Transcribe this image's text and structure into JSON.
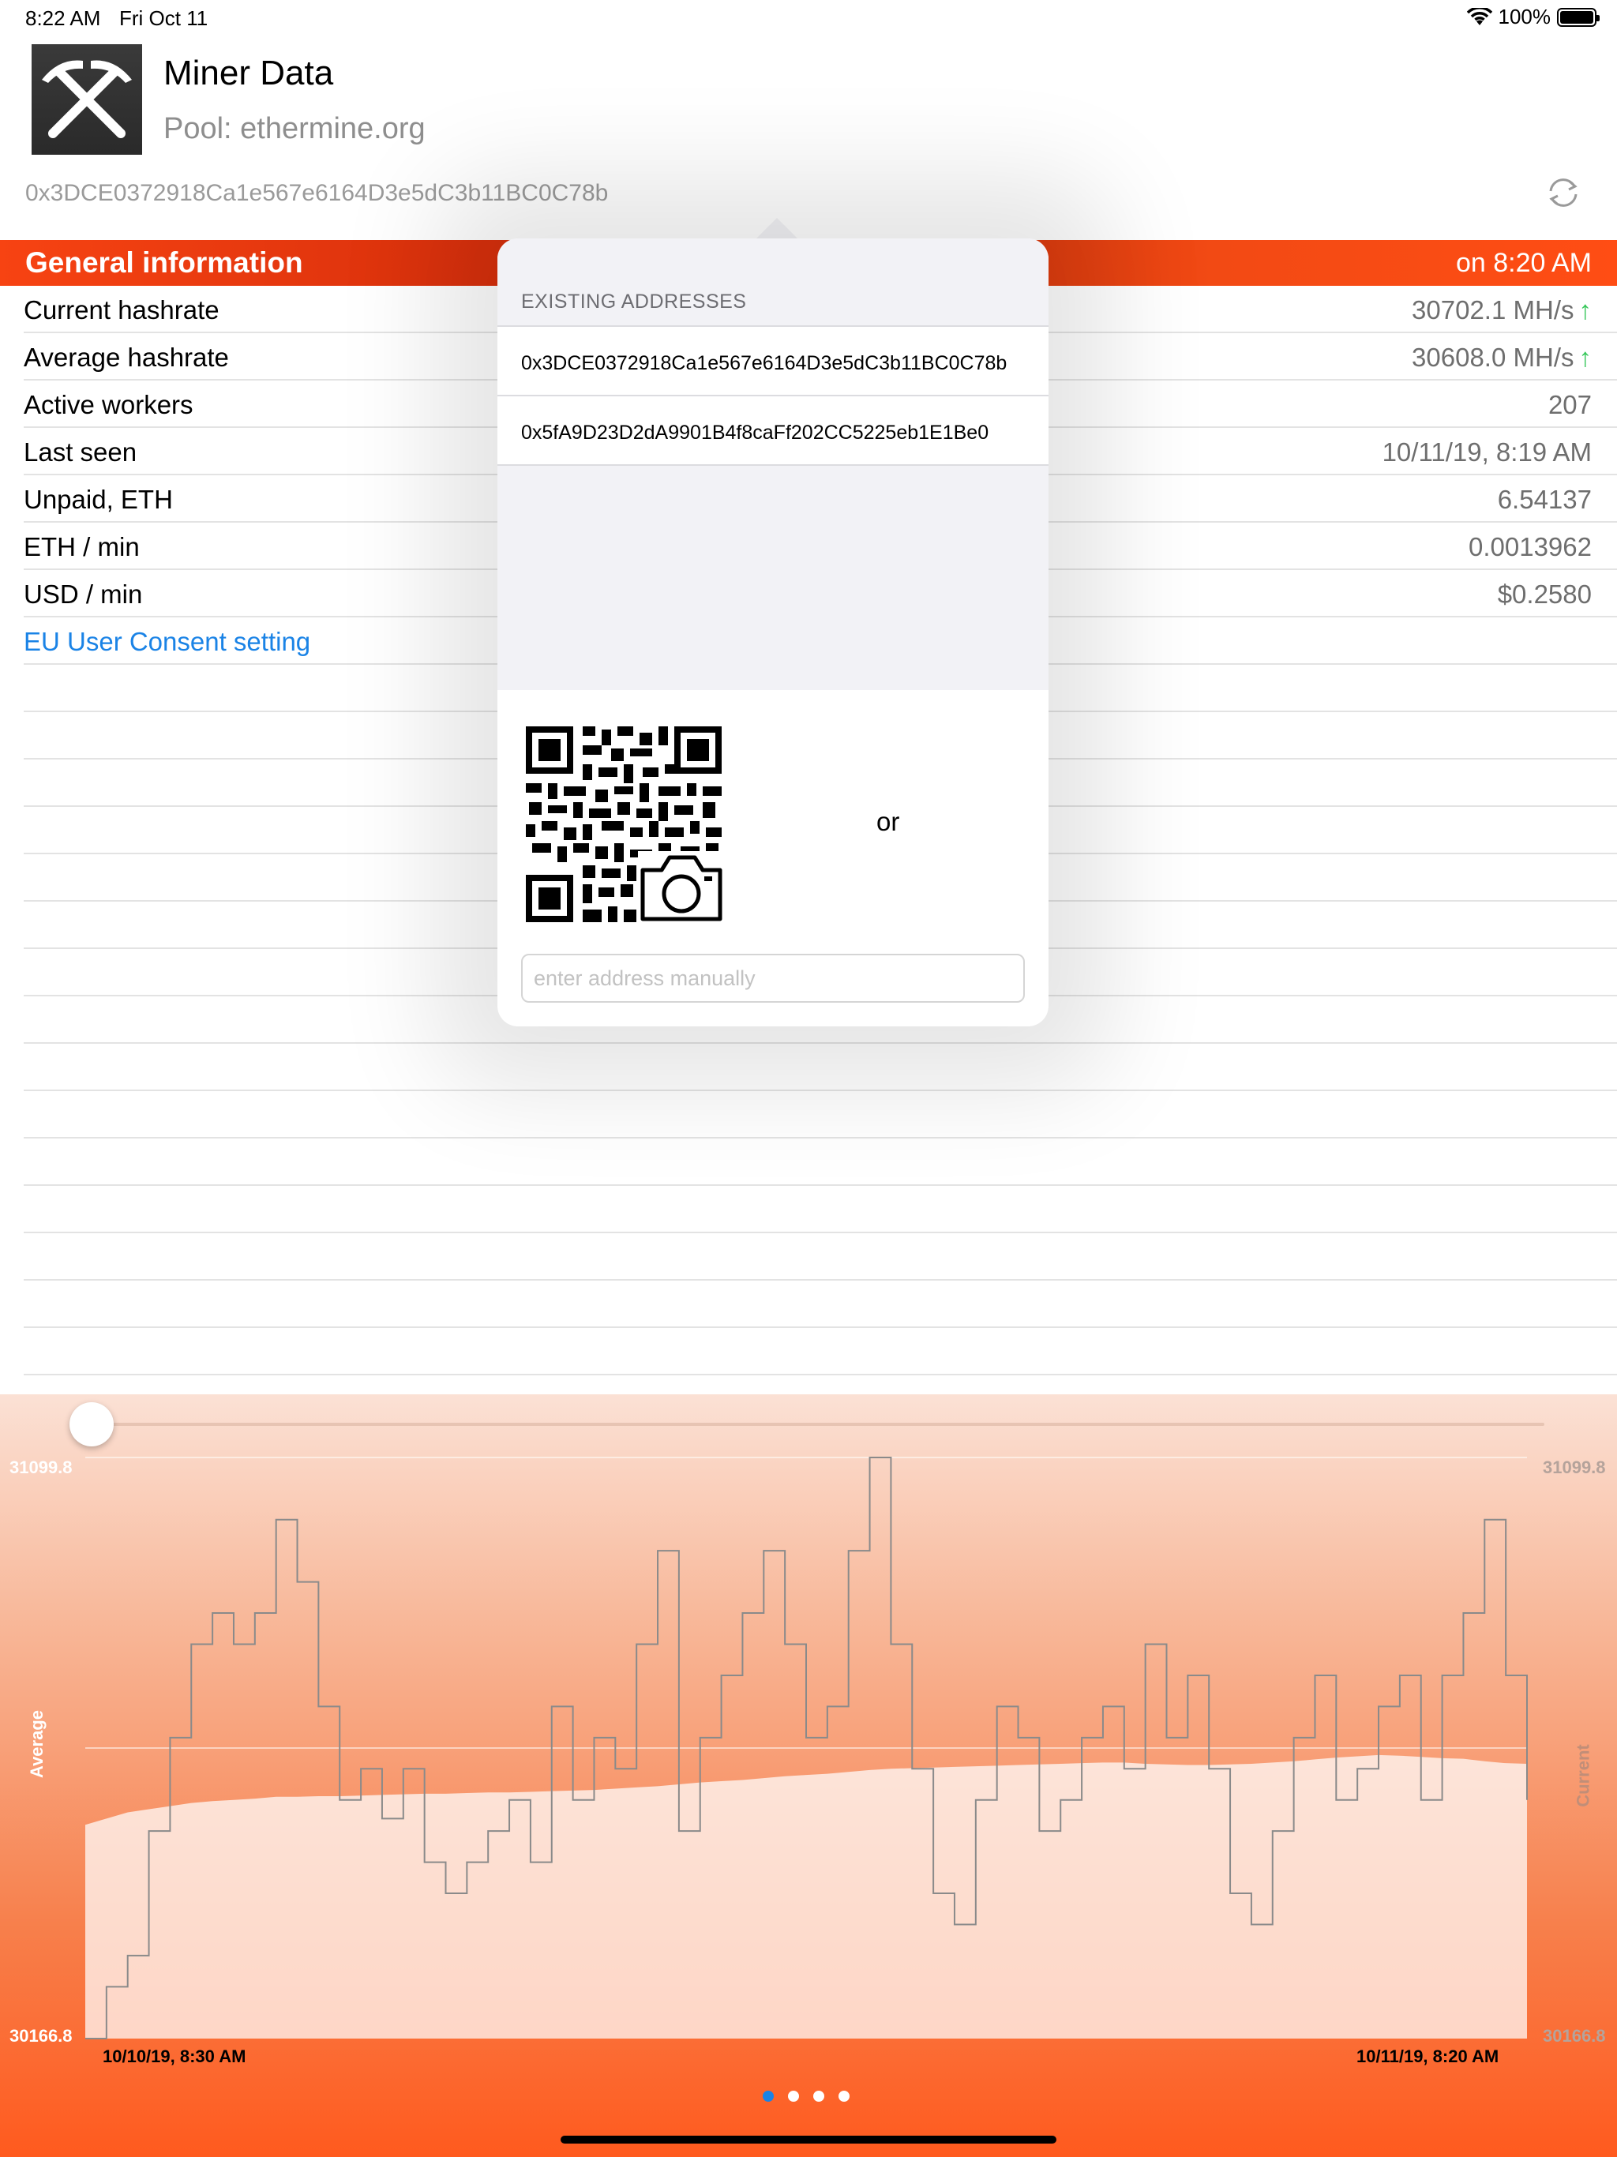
{
  "status_bar": {
    "time": "8:22 AM",
    "date": "Fri Oct 11",
    "battery": "100%"
  },
  "header": {
    "title": "Miner Data",
    "pool": "Pool: ethermine.org",
    "address": "0x3DCE0372918Ca1e567e6164D3e5dC3b11BC0C78b"
  },
  "section": {
    "title": "General information",
    "updated": "on 8:20 AM"
  },
  "rows": [
    {
      "label": "Current hashrate",
      "value": "30702.1 MH/s",
      "arrow": "↑"
    },
    {
      "label": "Average hashrate",
      "value": "30608.0 MH/s",
      "arrow": "↑"
    },
    {
      "label": "Active workers",
      "value": "207"
    },
    {
      "label": "Last seen",
      "value": "10/11/19, 8:19 AM"
    },
    {
      "label": "Unpaid, ETH",
      "value": "6.54137"
    },
    {
      "label": "ETH / min",
      "value": "0.0013962"
    },
    {
      "label": "USD / min",
      "value": "$0.2580"
    }
  ],
  "consent_link": "EU User Consent setting",
  "popover": {
    "heading": "EXISTING ADDRESSES",
    "addresses": [
      "0x3DCE0372918Ca1e567e6164D3e5dC3b11BC0C78b",
      "0x5fA9D23D2dA9901B4f8caFf202CC5225eb1E1Be0"
    ],
    "or_text": "or",
    "input_placeholder": "enter address manually"
  },
  "chart_data": {
    "type": "line",
    "y_left_labels": {
      "max": "31099.8",
      "min": "30166.8"
    },
    "y_right_labels": {
      "max": "31099.8",
      "min": "30166.8"
    },
    "ylim": [
      30166.8,
      31099.8
    ],
    "left_axis_title": "Average",
    "right_axis_title": "Current",
    "x_start_label": "10/10/19, 8:30 AM",
    "x_end_label": "10/11/19, 8:20 AM",
    "series": [
      {
        "name": "Current",
        "values": [
          30166.8,
          30250,
          30300,
          30500,
          30650,
          30800,
          30850,
          30800,
          30850,
          31000,
          30900,
          30700,
          30550,
          30600,
          30520,
          30600,
          30450,
          30400,
          30450,
          30500,
          30550,
          30450,
          30700,
          30550,
          30650,
          30600,
          30800,
          30950,
          30500,
          30650,
          30750,
          30850,
          30950,
          30800,
          30650,
          30700,
          30950,
          31099.8,
          30800,
          30600,
          30400,
          30350,
          30550,
          30700,
          30650,
          30500,
          30550,
          30650,
          30700,
          30600,
          30800,
          30650,
          30750,
          30600,
          30400,
          30350,
          30500,
          30650,
          30750,
          30550,
          30600,
          30700,
          30750,
          30550,
          30750,
          30850,
          31000,
          30750,
          30550
        ]
      },
      {
        "name": "Average",
        "values": [
          30510,
          30520,
          30530,
          30535,
          30540,
          30545,
          30548,
          30550,
          30552,
          30555,
          30555,
          30556,
          30556,
          30557,
          30558,
          30559,
          30560,
          30560,
          30561,
          30562,
          30562,
          30563,
          30564,
          30565,
          30566,
          30568,
          30570,
          30572,
          30575,
          30578,
          30580,
          30582,
          30585,
          30588,
          30590,
          30592,
          30595,
          30598,
          30600,
          30601,
          30602,
          30603,
          30604,
          30605,
          30606,
          30607,
          30608,
          30609,
          30610,
          30610,
          30608,
          30607,
          30606,
          30606,
          30607,
          30608,
          30610,
          30612,
          30615,
          30618,
          30620,
          30622,
          30621,
          30619,
          30617,
          30616,
          30612,
          30609,
          30608
        ]
      }
    ]
  },
  "pagination": {
    "pages": 4,
    "active": 0
  },
  "colors": {
    "accent_orange": "#f74312",
    "link_blue": "#1a83e6",
    "up_green": "#35c759"
  }
}
